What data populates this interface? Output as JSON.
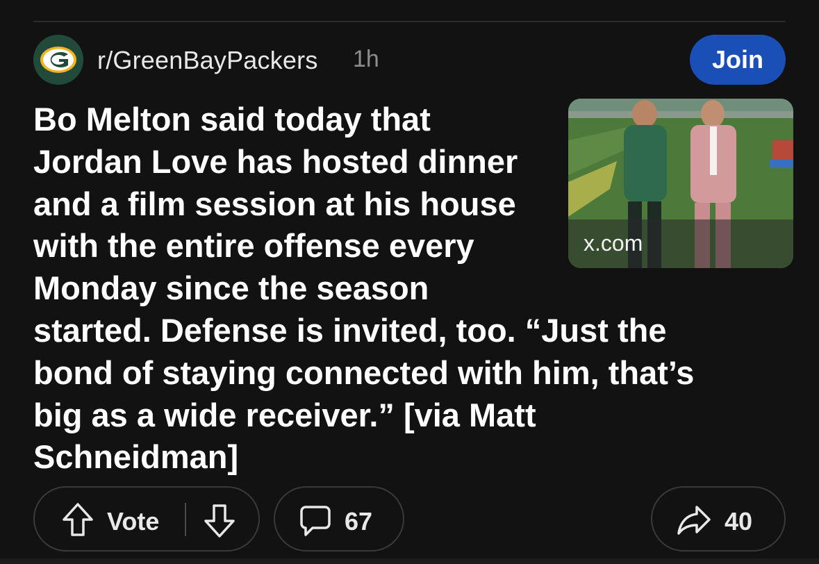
{
  "post": {
    "community": "r/GreenBayPackers",
    "time_ago": "1h",
    "join_label": "Join",
    "title": "Bo Melton said today that Jordan Love has hosted dinner and a film session at his house with the entire offense every Monday since the season started. Defense is invited, too. “Just the bond of staying connected with him, that’s big as a wide receiver.” [via Matt Schneidman]",
    "link_domain": "x.com"
  },
  "actions": {
    "vote_label": "Vote",
    "comment_count": "67",
    "share_count": "40"
  },
  "icons": {
    "community_avatar": "packers-g-logo-icon",
    "upvote": "arrow-up-icon",
    "downvote": "arrow-down-icon",
    "comment": "comment-bubble-icon",
    "share": "share-arrow-icon"
  },
  "colors": {
    "background": "#121212",
    "join_button": "#1a4fb8",
    "packers_green": "#214a3a",
    "packers_gold": "#f5b31d"
  }
}
